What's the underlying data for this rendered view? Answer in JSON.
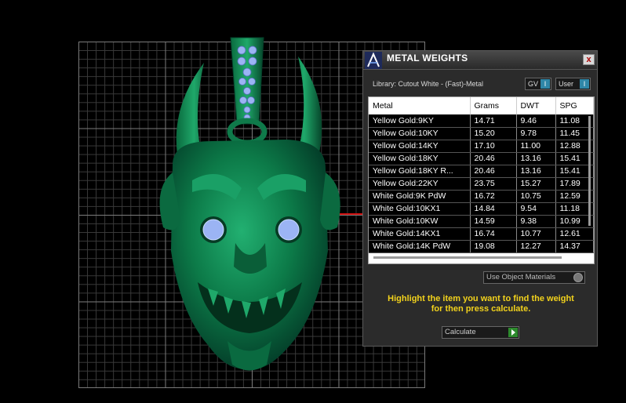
{
  "panel": {
    "title": "METAL WEIGHTS",
    "close_label": "x",
    "library_label": "Library: Cutout White - (Fast)-Metal",
    "toggles": [
      {
        "label": "GV",
        "indicator": "I"
      },
      {
        "label": "User",
        "indicator": "I"
      }
    ],
    "table": {
      "columns": [
        "Metal",
        "Grams",
        "DWT",
        "SPG"
      ],
      "rows": [
        [
          "Yellow Gold:9KY",
          "14.71",
          "9.46",
          "11.08"
        ],
        [
          "Yellow Gold:10KY",
          "15.20",
          "9.78",
          "11.45"
        ],
        [
          "Yellow Gold:14KY",
          "17.10",
          "11.00",
          "12.88"
        ],
        [
          "Yellow Gold:18KY",
          "20.46",
          "13.16",
          "15.41"
        ],
        [
          "Yellow Gold:18KY R...",
          "20.46",
          "13.16",
          "15.41"
        ],
        [
          "Yellow Gold:22KY",
          "23.75",
          "15.27",
          "17.89"
        ],
        [
          "White Gold:9K PdW",
          "16.72",
          "10.75",
          "12.59"
        ],
        [
          "White Gold:10KX1",
          "14.84",
          "9.54",
          "11.18"
        ],
        [
          "White Gold:10KW",
          "14.59",
          "9.38",
          "10.99"
        ],
        [
          "White Gold:14KX1",
          "16.74",
          "10.77",
          "12.61"
        ],
        [
          "White Gold:14K PdW",
          "19.08",
          "12.27",
          "14.37"
        ]
      ]
    },
    "use_materials_label": "Use Object Materials",
    "hint_line1": "Highlight the item you want to find the weight",
    "hint_line2": "for then press calculate.",
    "calculate_label": "Calculate"
  },
  "colors": {
    "model_green": "#0f7a4a",
    "gem_blue": "#8fa8f0",
    "hint_yellow": "#f2d21c"
  }
}
